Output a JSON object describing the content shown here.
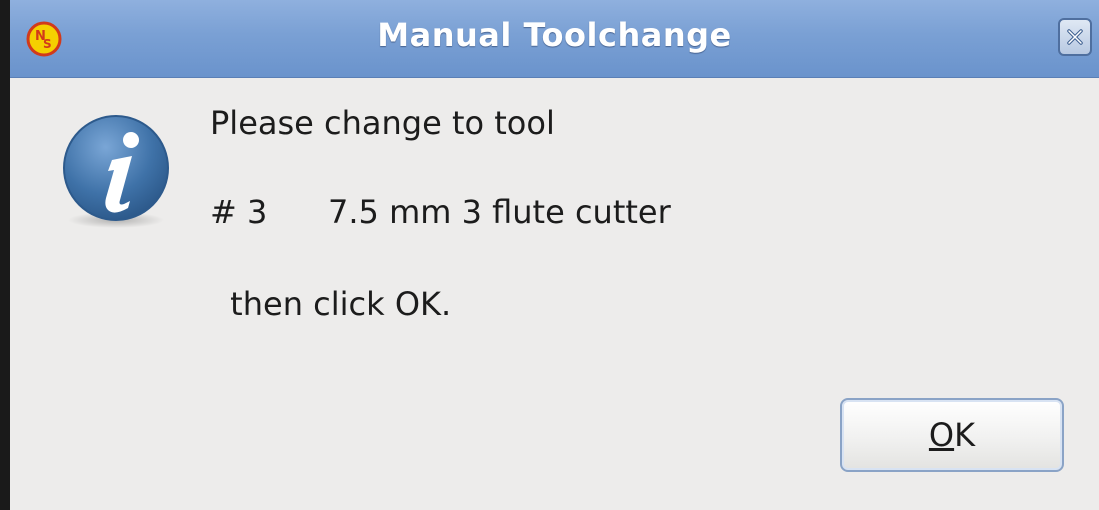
{
  "window": {
    "title": "Manual Toolchange",
    "close_icon": "close-icon",
    "app_icon": "linuxcnc-logo-icon"
  },
  "dialog": {
    "icon": "info-icon",
    "line1": "Please change to tool",
    "tool_number": "# 3",
    "tool_description": "7.5 mm 3 flute cutter",
    "line3": " then click OK."
  },
  "buttons": {
    "ok_mnemonic": "O",
    "ok_rest": "K"
  },
  "colors": {
    "titlebar": "#7aa0d4",
    "dialog_bg": "#edeceb",
    "info_icon": "#3f72a8"
  }
}
